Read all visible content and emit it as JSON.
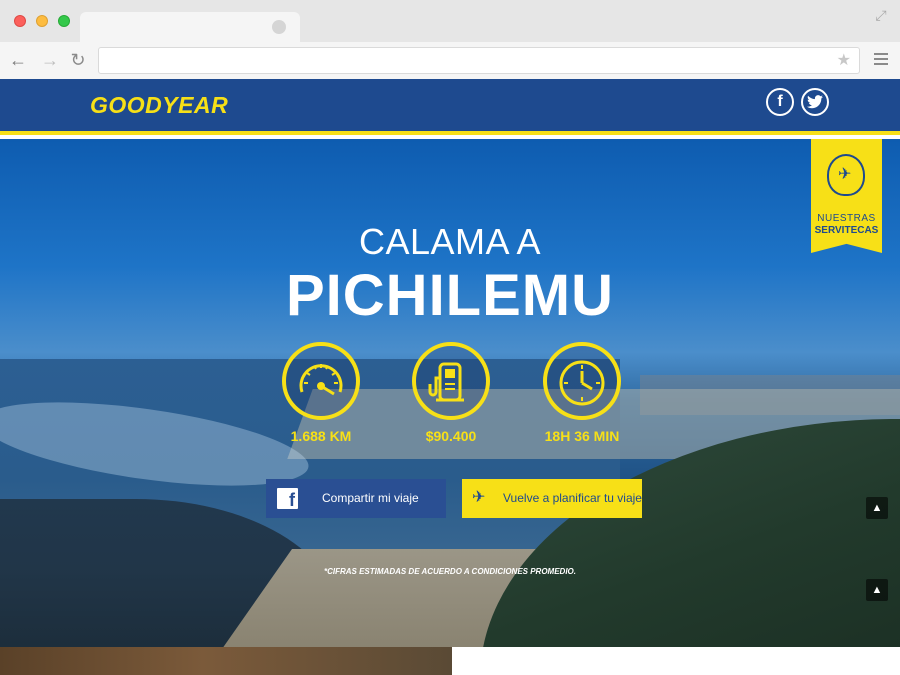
{
  "browser": {
    "url": "",
    "icons": [
      "close-dot",
      "minimize-dot",
      "maximize-dot",
      "back-icon",
      "forward-icon",
      "reload-icon",
      "star-icon",
      "menu-icon",
      "expand-icon"
    ]
  },
  "header": {
    "logo_text": "GOODYEAR",
    "social": {
      "facebook": "f",
      "twitter": "t"
    }
  },
  "badge": {
    "line1": "NUESTRAS",
    "line2": "SERVITECAS"
  },
  "route": {
    "from": "CALAMA A",
    "to": "PICHILEMU"
  },
  "stats": [
    {
      "icon": "speedometer-icon",
      "value": "1.688 KM"
    },
    {
      "icon": "fuel-pump-icon",
      "value": "$90.400"
    },
    {
      "icon": "clock-icon",
      "value": "18H 36 MIN"
    }
  ],
  "buttons": {
    "share": "Compartir mi viaje",
    "plan": "Vuelve a planificar tu viaje"
  },
  "disclaimer": "*CIFRAS ESTIMADAS DE ACUERDO A CONDICIONES PROMEDIO.",
  "colors": {
    "brand_blue": "#1e4a8f",
    "brand_yellow": "#f7e017",
    "facebook_blue": "#2a4f93"
  }
}
